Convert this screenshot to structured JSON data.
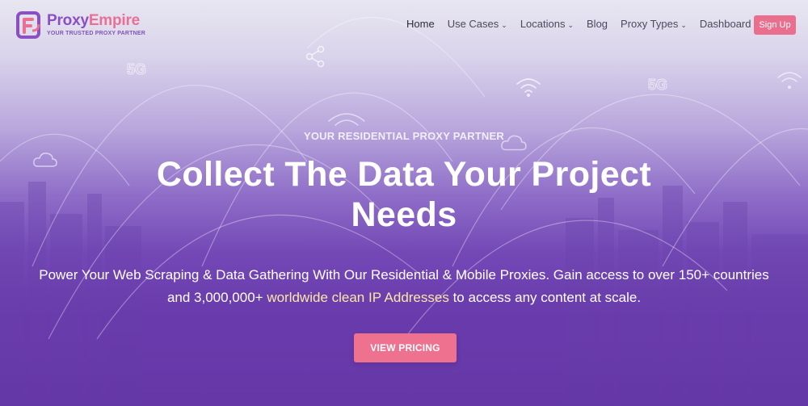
{
  "brand": {
    "name_part1": "Proxy",
    "name_part2": "Empire",
    "tagline": "YOUR TRUSTED PROXY PARTNER",
    "colors": {
      "purple": "#8a4fc3",
      "pink": "#ea6f95"
    }
  },
  "nav": {
    "items": [
      {
        "label": "Home",
        "dropdown": false
      },
      {
        "label": "Use Cases",
        "dropdown": true
      },
      {
        "label": "Locations",
        "dropdown": true
      },
      {
        "label": "Blog",
        "dropdown": false
      },
      {
        "label": "Proxy Types",
        "dropdown": true
      },
      {
        "label": "Dashboard",
        "dropdown": false
      }
    ],
    "signup_label": "Sign Up"
  },
  "hero": {
    "eyebrow": "YOUR RESIDENTIAL PROXY PARTNER",
    "headline_line1": "Collect The Data Your Project",
    "headline_line2": "Needs",
    "sub_part1": "Power Your Web Scraping & Data Gathering  With Our Residential & Mobile Proxies. Gain access to over 150+ countries and 3,000,000+ ",
    "sub_highlight": "worldwide clean IP Addresses",
    "sub_part2": " to access any content at scale.",
    "cta_label": "VIEW PRICING"
  },
  "icons": [
    "5g-icon",
    "share-icon",
    "wifi-icon",
    "cloud-icon",
    "chevron-down-icon"
  ],
  "theme": {
    "cta_color": "#ee7290",
    "signup_color": "#ea6f8e",
    "highlight_text": "#fbe7a6"
  }
}
